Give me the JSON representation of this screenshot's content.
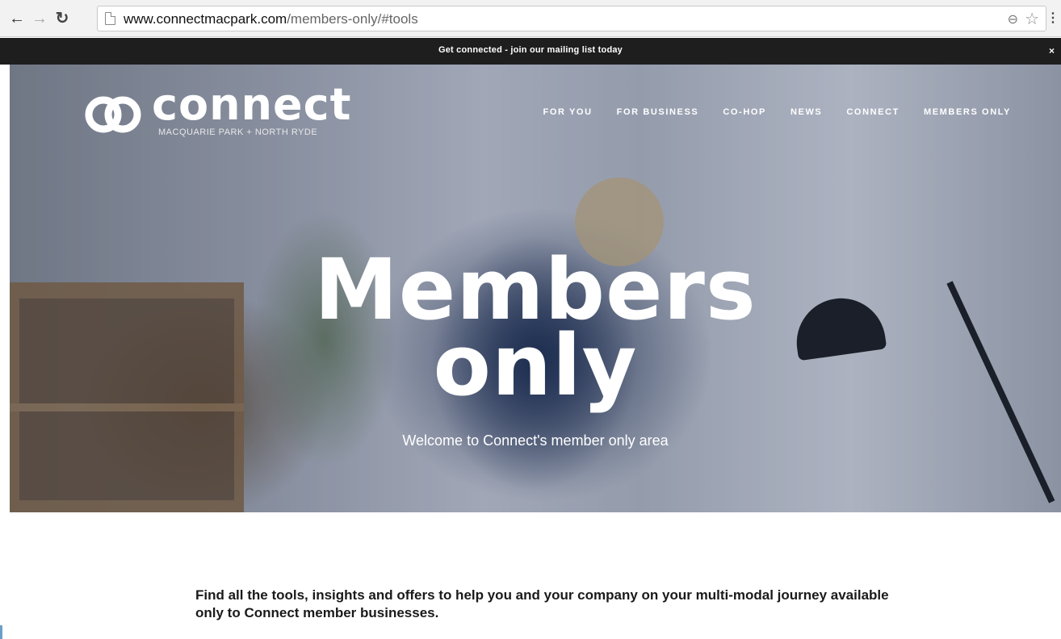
{
  "browser": {
    "url_host": "www.connectmacpark.com",
    "url_path": "/members-only/#tools",
    "icons": [
      "back-arrow-icon",
      "forward-arrow-icon",
      "reload-icon",
      "page-icon",
      "zoom-icon",
      "star-icon",
      "menu-icon"
    ]
  },
  "announcement": {
    "text": "Get connected - join our mailing list today",
    "close": "×"
  },
  "logo": {
    "word": "connect",
    "tagline": "MACQUARIE PARK + NORTH RYDE"
  },
  "nav": {
    "items": [
      {
        "label": "FOR YOU"
      },
      {
        "label": "FOR BUSINESS"
      },
      {
        "label": "CO-HOP"
      },
      {
        "label": "NEWS"
      },
      {
        "label": "CONNECT"
      },
      {
        "label": "MEMBERS ONLY"
      }
    ]
  },
  "hero": {
    "title_line1": "Members",
    "title_line2": "only",
    "subtitle": "Welcome to Connect's member only area"
  },
  "intro": {
    "text": "Find all the tools, insights and offers to help you and your company on your multi-modal journey available only to Connect member businesses."
  },
  "colors": {
    "announce_bg": "#1e1e1e",
    "hero_text": "#ffffff"
  }
}
